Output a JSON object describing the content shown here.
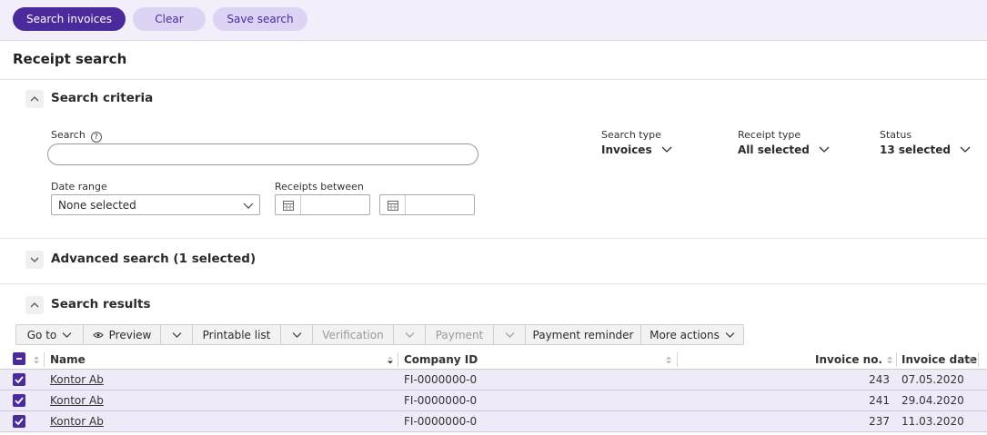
{
  "toolbar": {
    "search_invoices": "Search invoices",
    "clear": "Clear",
    "save_search": "Save search"
  },
  "page_title": "Receipt search",
  "criteria": {
    "heading": "Search criteria",
    "search_label": "Search",
    "search_value": "",
    "date_range_label": "Date range",
    "date_range_value": "None selected",
    "receipts_between_label": "Receipts between",
    "search_type_label": "Search type",
    "search_type_value": "Invoices",
    "receipt_type_label": "Receipt type",
    "receipt_type_value": "All selected",
    "status_label": "Status",
    "status_value": "13 selected"
  },
  "advanced": {
    "heading": "Advanced search (1 selected)"
  },
  "results": {
    "heading": "Search results",
    "actions": {
      "go_to": "Go to",
      "preview": "Preview",
      "printable_list": "Printable list",
      "verification": "Verification",
      "payment": "Payment",
      "payment_reminder": "Payment reminder",
      "more_actions": "More actions"
    },
    "columns": {
      "name": "Name",
      "company_id": "Company ID",
      "invoice_no": "Invoice no.",
      "invoice_date": "Invoice date"
    },
    "rows": [
      {
        "name": "Kontor Ab",
        "company_id": "FI-0000000-0",
        "invoice_no": "243",
        "invoice_date": "07.05.2020"
      },
      {
        "name": "Kontor Ab",
        "company_id": "FI-0000000-0",
        "invoice_no": "241",
        "invoice_date": "29.04.2020"
      },
      {
        "name": "Kontor Ab",
        "company_id": "FI-0000000-0",
        "invoice_no": "237",
        "invoice_date": "11.03.2020"
      }
    ]
  },
  "colors": {
    "primary": "#4b2a9c",
    "secondary": "#ddd3f5",
    "row_bg": "#efeaf8",
    "bar_bg": "#f3effa"
  },
  "icons": [
    "help-icon",
    "calendar-icon",
    "chevron-down-icon",
    "chevron-up-icon",
    "eye-icon",
    "checkbox-checked-icon",
    "checkbox-indeterminate-icon",
    "sort-icon"
  ]
}
